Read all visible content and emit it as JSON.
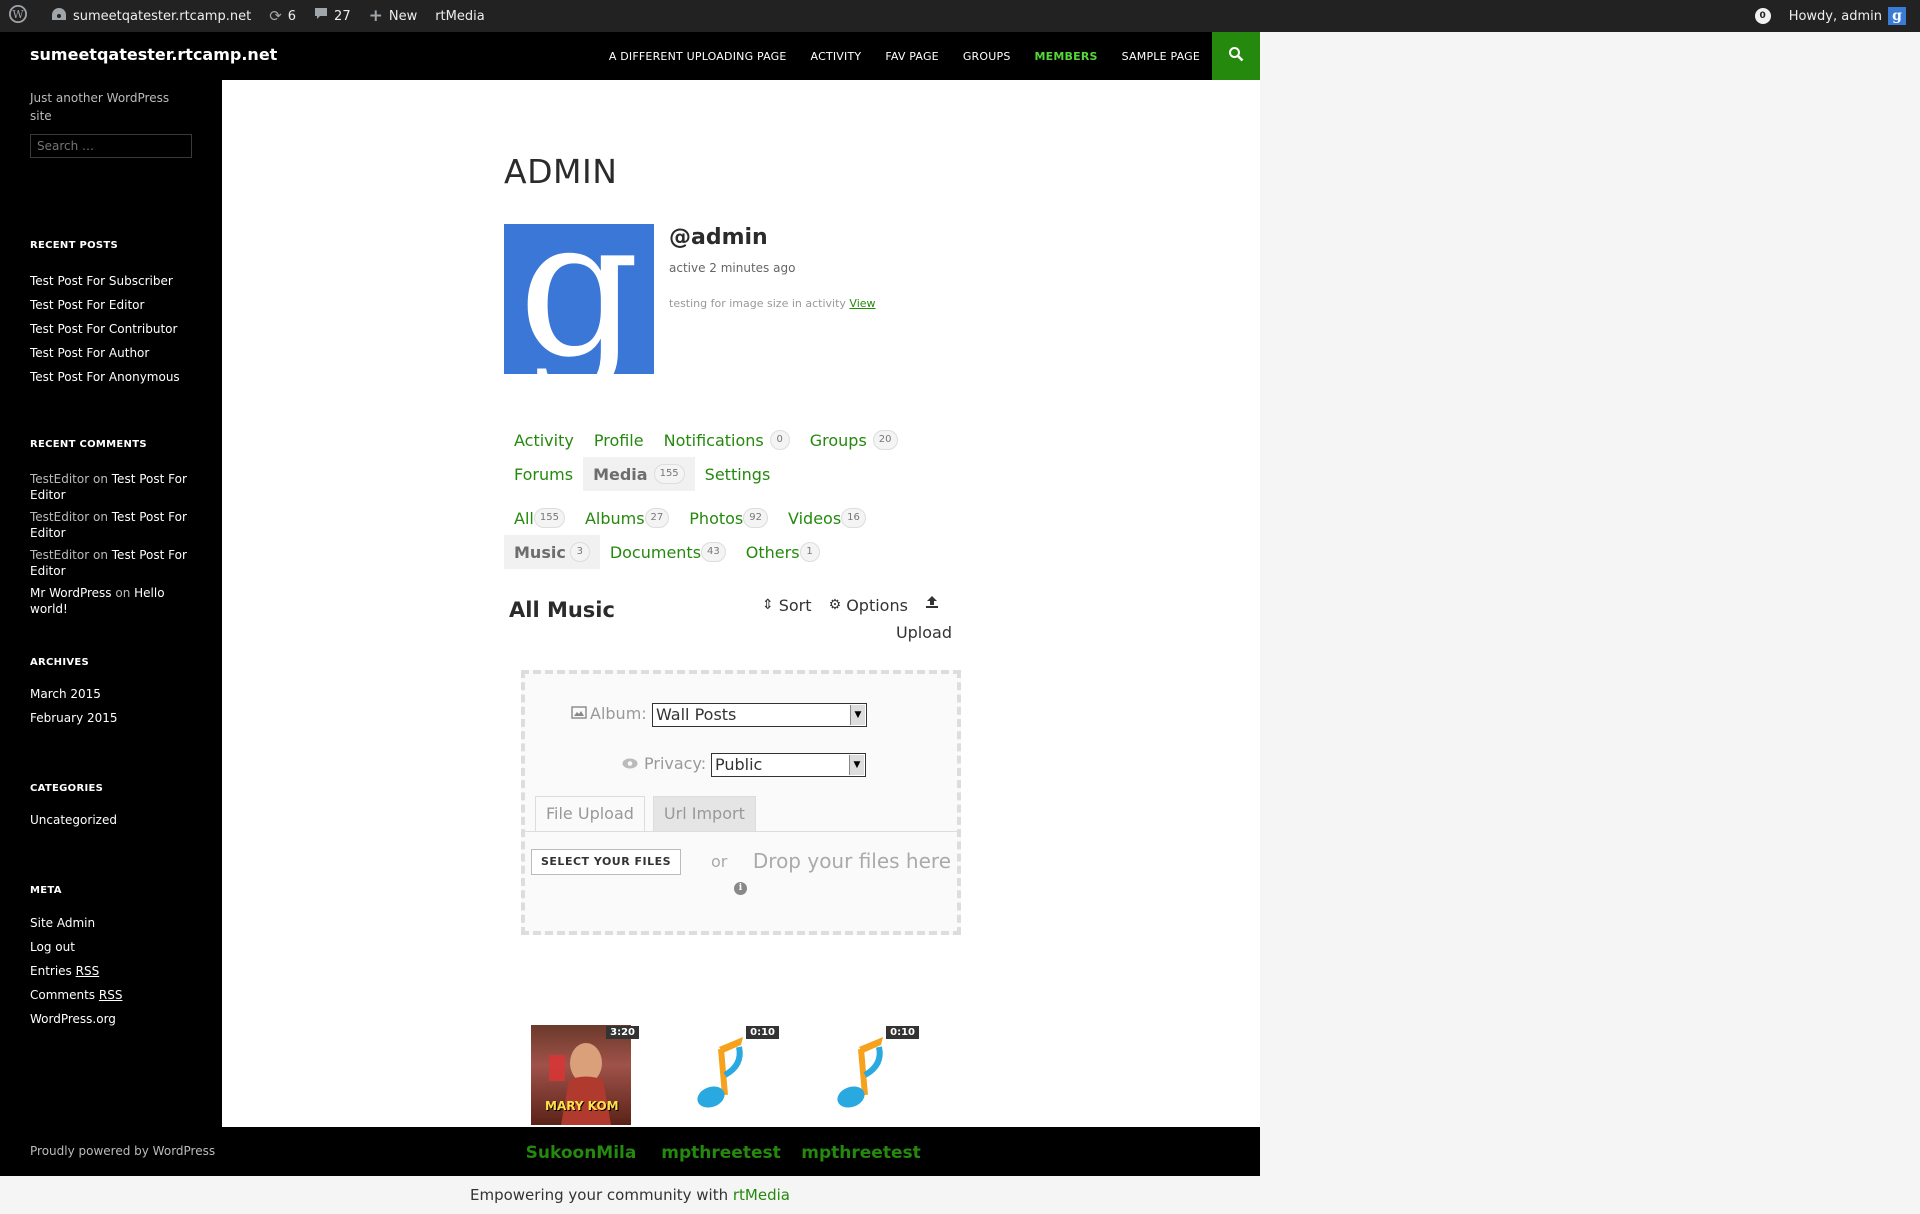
{
  "adminbar": {
    "site_name": "sumeetqatester.rtcamp.net",
    "updates_count": "6",
    "comments_count": "27",
    "new_label": "New",
    "rtmedia_label": "rtMedia",
    "notifications_count": "0",
    "howdy": "Howdy, admin"
  },
  "site": {
    "title": "sumeetqatester.rtcamp.net",
    "tagline": "Just another WordPress site",
    "search_placeholder": "Search …",
    "nav": [
      "A DIFFERENT UPLOADING PAGE",
      "ACTIVITY",
      "FAV PAGE",
      "GROUPS",
      "MEMBERS",
      "SAMPLE PAGE"
    ],
    "nav_active": "MEMBERS",
    "footer_credit": "Proudly powered by WordPress"
  },
  "sidebar": {
    "recent_posts_title": "RECENT POSTS",
    "recent_posts": [
      "Test Post For Subscriber",
      "Test Post For Editor",
      "Test Post For Contributor",
      "Test Post For Author",
      "Test Post For Anonymous"
    ],
    "recent_comments_title": "RECENT COMMENTS",
    "recent_comments": [
      {
        "author": "TestEditor",
        "on": "on",
        "post": "Test Post For Editor"
      },
      {
        "author": "TestEditor",
        "on": "on",
        "post": "Test Post For Editor"
      },
      {
        "author": "TestEditor",
        "on": "on",
        "post": "Test Post For Editor"
      },
      {
        "author": "Mr WordPress",
        "on": "on",
        "post": "Hello world!"
      }
    ],
    "archives_title": "ARCHIVES",
    "archives": [
      "March 2015",
      "February 2015"
    ],
    "categories_title": "CATEGORIES",
    "categories": [
      "Uncategorized"
    ],
    "meta_title": "META",
    "meta": {
      "site_admin": "Site Admin",
      "log_out": "Log out",
      "entries": "Entries",
      "comments": "Comments",
      "rss": "RSS",
      "wordpress_org": "WordPress.org"
    }
  },
  "profile": {
    "page_title": "ADMIN",
    "avatar_letter": "g",
    "handle": "@admin",
    "activity": "active 2 minutes ago",
    "latest_update": "testing for image size in activity",
    "view_link": "View"
  },
  "profile_tabs": [
    {
      "label": "Activity",
      "count": ""
    },
    {
      "label": "Profile",
      "count": ""
    },
    {
      "label": "Notifications",
      "count": "0"
    },
    {
      "label": "Groups",
      "count": "20"
    },
    {
      "label": "Forums",
      "count": ""
    },
    {
      "label": "Media",
      "count": "155"
    },
    {
      "label": "Settings",
      "count": ""
    }
  ],
  "media_tabs": [
    {
      "label": "All",
      "count": "155"
    },
    {
      "label": "Albums",
      "count": "27"
    },
    {
      "label": "Photos",
      "count": "92"
    },
    {
      "label": "Videos",
      "count": "16"
    },
    {
      "label": "Music",
      "count": "3"
    },
    {
      "label": "Documents",
      "count": "43"
    },
    {
      "label": "Others",
      "count": "1"
    }
  ],
  "gallery": {
    "title": "All Music",
    "sort_label": "Sort",
    "options_label": "Options",
    "upload_label": "Upload"
  },
  "uploader": {
    "album_label": "Album:",
    "album_value": "Wall Posts",
    "privacy_label": "Privacy:",
    "privacy_value": "Public",
    "tab_file_upload": "File Upload",
    "tab_url_import": "Url Import",
    "select_files": "SELECT YOUR FILES",
    "or": "or",
    "drop_text": "Drop your files here"
  },
  "media_items": [
    {
      "title": "SukoonMila",
      "duration": "3:20",
      "thumb": "poster",
      "poster_text": "MARY KOM"
    },
    {
      "title": "mpthreetest",
      "duration": "0:10",
      "thumb": "music-note"
    },
    {
      "title": "mpthreetest",
      "duration": "0:10",
      "thumb": "music-note"
    }
  ],
  "rtmedia_footer": {
    "text": "Empowering your community with",
    "link": "rtMedia"
  },
  "colors": {
    "accent_green": "#24890d",
    "nav_active": "#55d737",
    "adminbar_bg": "#222222",
    "avatar_blue": "#3a77d6"
  }
}
